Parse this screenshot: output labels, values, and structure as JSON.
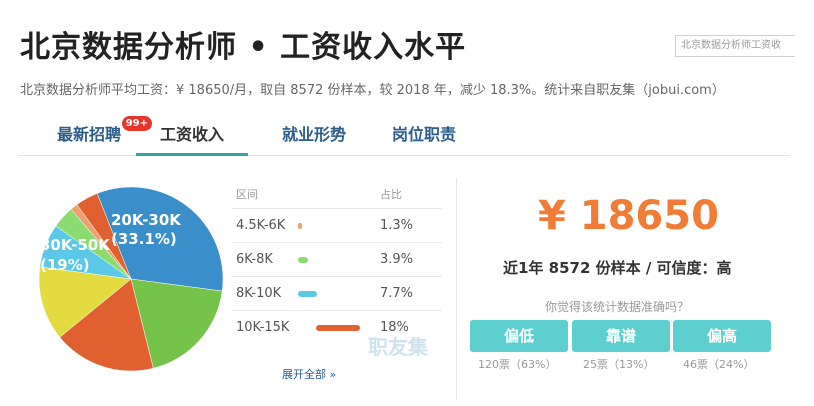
{
  "header": {
    "title": "北京数据分析师 • 工资收入水平",
    "search_value": "北京数据分析师工资收",
    "summary": "北京数据分析师平均工资：¥ 18650/月，取自 8572 份样本，较 2018 年，减少 18.3%。统计来自职友集（jobui.com）"
  },
  "tabs": [
    {
      "label": "最新招聘",
      "badge": "99+"
    },
    {
      "label": "工资收入"
    },
    {
      "label": "就业形势"
    },
    {
      "label": "岗位职责"
    }
  ],
  "pie": {
    "labels": [
      {
        "text": "20K-30K"
      },
      {
        "text": "(33.1%)"
      },
      {
        "text": "30K-50K"
      },
      {
        "text": "(19%)"
      }
    ]
  },
  "chart_data": {
    "type": "pie",
    "slices": [
      {
        "label": "20K-30K",
        "value": 33.1,
        "color": "#3a8fcb"
      },
      {
        "label": "30K-50K",
        "value": 19,
        "color": "#75c34a"
      },
      {
        "label": "10K-15K",
        "value": 18,
        "color": "#e06030"
      },
      {
        "label": "",
        "value": 13,
        "color": "#e2dc40"
      },
      {
        "label": "8K-10K",
        "value": 7.7,
        "color": "#5bc8e8"
      },
      {
        "label": "6K-8K",
        "value": 3.9,
        "color": "#8bdc6e"
      },
      {
        "label": "4.5K-6K",
        "value": 1.3,
        "color": "#f0a070"
      },
      {
        "label": "",
        "value": 4,
        "color": "#e06030"
      }
    ]
  },
  "table": {
    "col_range": "区间",
    "col_pct": "占比",
    "rows": [
      {
        "range": "4.5K-6K",
        "pct": "1.3%",
        "value": 1.3,
        "color": "#f0a070"
      },
      {
        "range": "6K-8K",
        "pct": "3.9%",
        "value": 3.9,
        "color": "#8bdc6e"
      },
      {
        "range": "8K-10K",
        "pct": "7.7%",
        "value": 7.7,
        "color": "#5bc8e8"
      },
      {
        "range": "10K-15K",
        "pct": "18%",
        "value": 18,
        "color": "#e06030"
      }
    ],
    "expand_label": "展开全部 »",
    "watermark": "职友集"
  },
  "stats": {
    "salary": "¥ 18650",
    "sample_line": "近1年 8572 份样本 / 可信度：高",
    "question": "你觉得该统计数据准确吗？",
    "votes": [
      {
        "label": "偏低",
        "count": "120票（63%）"
      },
      {
        "label": "靠谱",
        "count": "25票（13%）"
      },
      {
        "label": "偏高",
        "count": "46票（24%）"
      }
    ]
  }
}
